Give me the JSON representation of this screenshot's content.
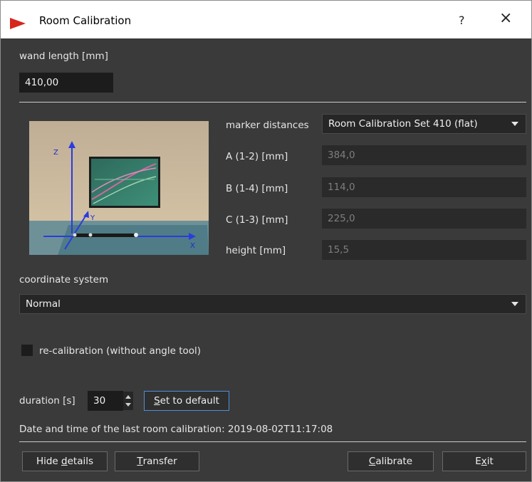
{
  "window": {
    "title": "Room Calibration",
    "help": "?",
    "close": "×"
  },
  "wand": {
    "label": "wand length [mm]",
    "value": "410,00"
  },
  "markers": {
    "label": "marker distances",
    "selected": "Room Calibration Set 410 (flat)",
    "a": {
      "label": "A (1-2) [mm]",
      "value": "384,0"
    },
    "b": {
      "label": "B (1-4) [mm]",
      "value": "114,0"
    },
    "c": {
      "label": "C (1-3) [mm]",
      "value": "225,0"
    },
    "height": {
      "label": "height [mm]",
      "value": "15,5"
    }
  },
  "photo": {
    "z": "Z",
    "y": "Y",
    "x": "X"
  },
  "coordinate": {
    "label": "coordinate system",
    "selected": "Normal"
  },
  "recalibration": {
    "label": "re-calibration (without angle tool)",
    "checked": false
  },
  "duration": {
    "label": "duration [s]",
    "value": "30"
  },
  "buttons": {
    "set_default": {
      "key": "S",
      "rest": "et to default"
    },
    "hide": {
      "pre": "Hide ",
      "key": "d",
      "rest": "etails"
    },
    "transfer": {
      "key": "T",
      "rest": "ransfer"
    },
    "calibrate": {
      "key": "C",
      "rest": "alibrate"
    },
    "exit": {
      "pre": "E",
      "key": "x",
      "rest": "it"
    }
  },
  "last_calibration": "Date and time of the last room calibration: 2019-08-02T11:17:08",
  "colors": {
    "background": "#3a3a3a",
    "field": "#1c1c1c",
    "accent": "#4f8fd8",
    "app_icon": "#d6261c"
  }
}
